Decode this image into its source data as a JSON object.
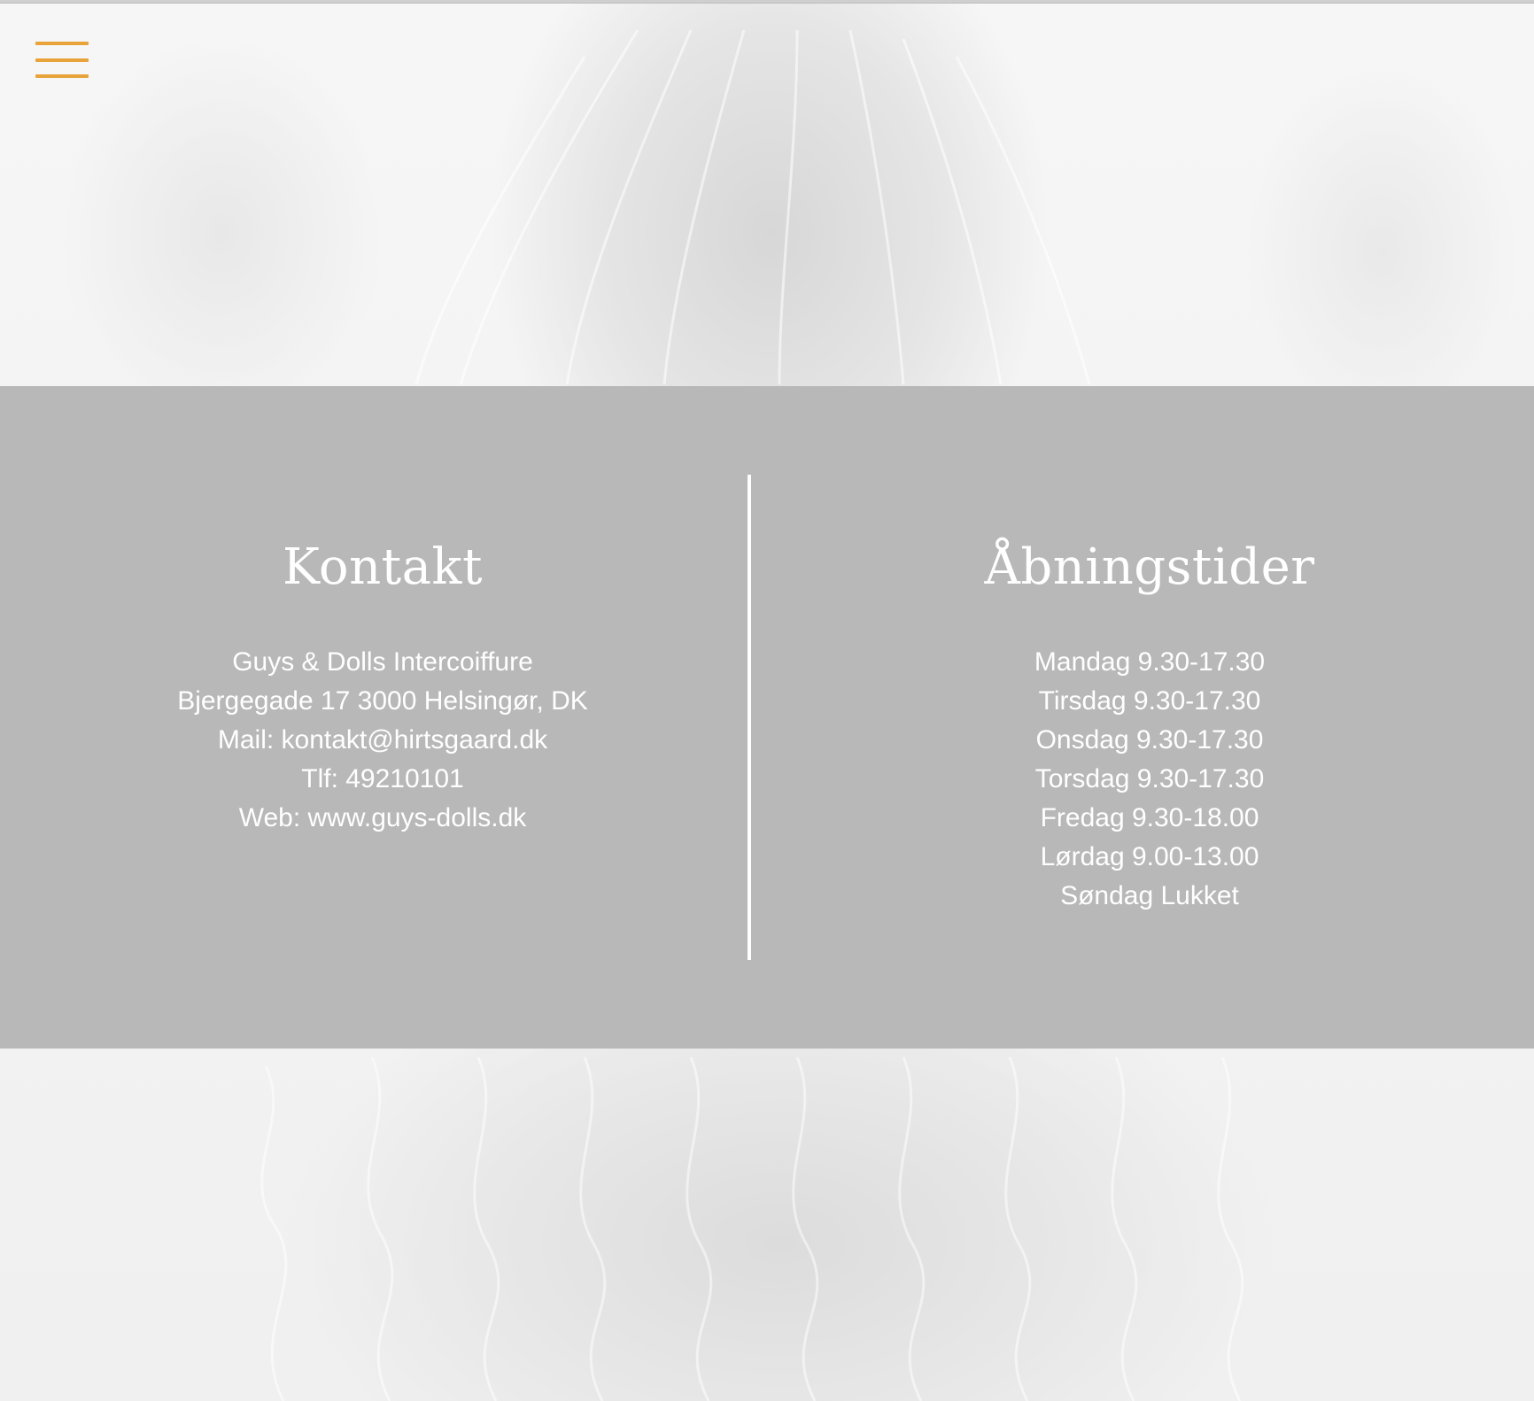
{
  "menu": {
    "icon": "hamburger-menu-icon",
    "accent_color": "#e8a33a"
  },
  "band_color": "#b8b8b8",
  "contact": {
    "heading": "Kontakt",
    "company": "Guys & Dolls Intercoiffure",
    "address": "Bjergegade 17 3000 Helsingør, DK",
    "mail": "Mail: kontakt@hirtsgaard.dk",
    "phone": "Tlf: 49210101",
    "web": "Web: www.guys-dolls.dk"
  },
  "hours": {
    "heading": "Åbningstider",
    "days": [
      "Mandag 9.30-17.30",
      "Tirsdag 9.30-17.30",
      "Onsdag 9.30-17.30",
      "Torsdag 9.30-17.30",
      "Fredag 9.30-18.00",
      "Lørdag 9.00-13.00",
      "Søndag Lukket"
    ]
  }
}
